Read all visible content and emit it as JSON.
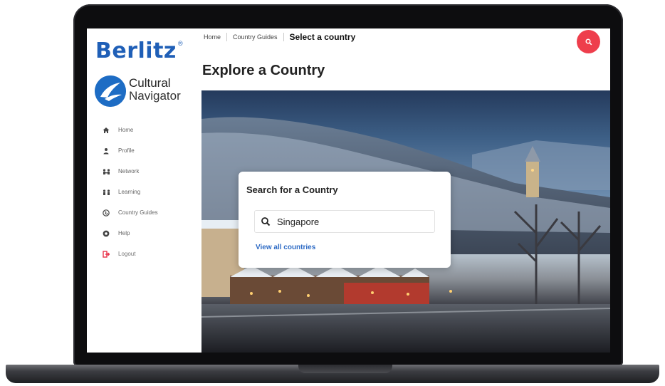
{
  "brand": {
    "name": "Berlitz",
    "mark": "®"
  },
  "product": {
    "line1": "Cultural",
    "line2": "Navigator"
  },
  "nav": {
    "items": [
      {
        "label": "Home",
        "icon": "home-icon"
      },
      {
        "label": "Profile",
        "icon": "user-icon"
      },
      {
        "label": "Network",
        "icon": "network-icon"
      },
      {
        "label": "Learning",
        "icon": "learning-icon"
      },
      {
        "label": "Country Guides",
        "icon": "globe-icon"
      },
      {
        "label": "Help",
        "icon": "help-icon"
      },
      {
        "label": "Logout",
        "icon": "logout-icon"
      }
    ]
  },
  "breadcrumb": {
    "items": [
      "Home",
      "Country Guides"
    ],
    "current": "Select a country"
  },
  "page": {
    "title": "Explore a Country"
  },
  "search_card": {
    "title": "Search for a Country",
    "value": "Singapore",
    "link": "View all countries"
  },
  "colors": {
    "brand_blue": "#1f5fb7",
    "accent_red": "#ee3e4c",
    "logout_red": "#e8334a",
    "link_blue": "#2e6bc5"
  }
}
